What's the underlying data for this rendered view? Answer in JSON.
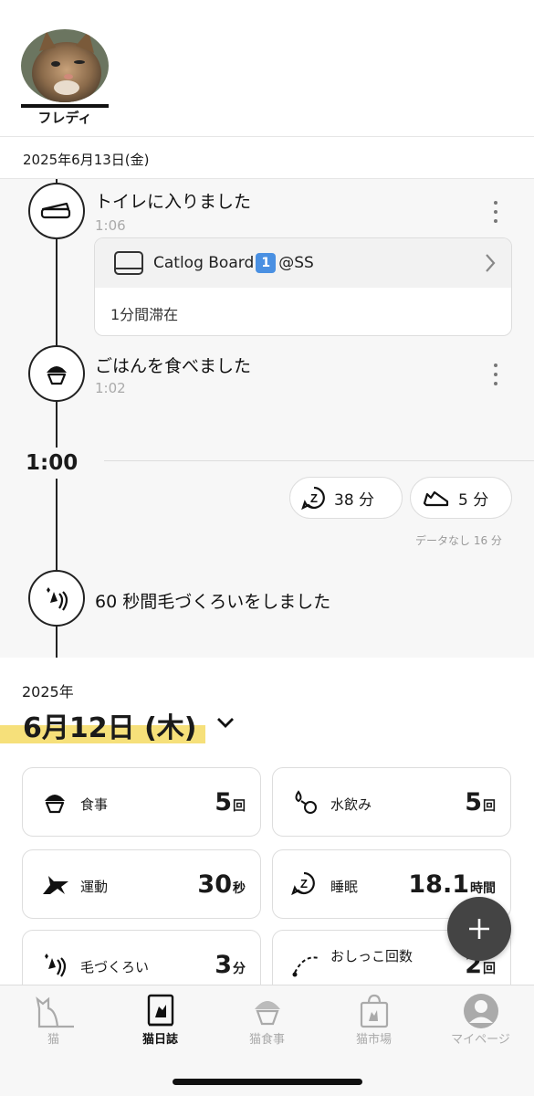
{
  "header": {
    "pet_name": "フレディ"
  },
  "date_bar": {
    "date": "2025年6月13日(金)"
  },
  "timeline": {
    "events": [
      {
        "title": "トイレに入りました",
        "time": "1:06",
        "icon": "litter-box-icon"
      },
      {
        "title": "ごはんを食べました",
        "time": "1:02",
        "icon": "food-bowl-icon"
      },
      {
        "title": "60 秒間毛づくろいをしました",
        "time": "",
        "icon": "grooming-icon"
      }
    ],
    "device_card": {
      "name_prefix": "Catlog Board",
      "badge": "1",
      "name_suffix": "@SS",
      "detail": "1分間滞在"
    },
    "hour_label": "1:00",
    "pills": [
      {
        "icon": "sleep-icon",
        "text": "38 分"
      },
      {
        "icon": "cat-lying-icon",
        "text": "5 分"
      }
    ],
    "nodata_text": "データなし 16 分"
  },
  "summary": {
    "year": "2025年",
    "date": "6月12日 (木)",
    "cards": [
      {
        "icon": "food-bowl-icon",
        "label": "食事",
        "value": "5",
        "unit": "回"
      },
      {
        "icon": "water-drink-icon",
        "label": "水飲み",
        "value": "5",
        "unit": "回"
      },
      {
        "icon": "running-cat-icon",
        "label": "運動",
        "value": "30",
        "unit": "秒"
      },
      {
        "icon": "sleep-icon",
        "label": "睡眠",
        "value": "18.1",
        "unit": "時間"
      },
      {
        "icon": "grooming-icon",
        "label": "毛づくろい",
        "value": "3",
        "unit": "分"
      },
      {
        "icon": "pee-icon",
        "label": "おしっこ回数",
        "value": "2",
        "unit": "回"
      }
    ]
  },
  "bottom_nav": {
    "items": [
      {
        "label": "猫",
        "icon": "cat-icon",
        "active": false
      },
      {
        "label": "猫日誌",
        "icon": "diary-icon",
        "active": true
      },
      {
        "label": "猫食事",
        "icon": "cat-food-icon",
        "active": false
      },
      {
        "label": "猫市場",
        "icon": "shopping-bag-icon",
        "active": false
      },
      {
        "label": "マイページ",
        "icon": "user-icon",
        "active": false
      }
    ]
  },
  "colors": {
    "highlight": "#f6e07a",
    "fab": "#444444",
    "badge": "#4a90e2"
  }
}
